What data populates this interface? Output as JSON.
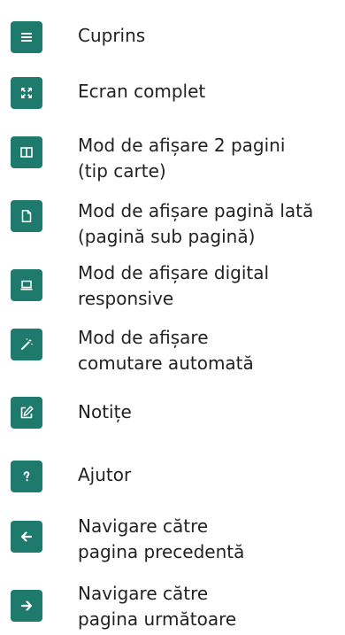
{
  "menu": {
    "accent_color": "#1f7a6e",
    "items": [
      {
        "label": "Cuprins",
        "icon": "list-icon"
      },
      {
        "label": "Ecran complet",
        "icon": "fullscreen-icon"
      },
      {
        "label": "Mod de afișare 2 pagini\n(tip carte)",
        "icon": "two-pages-icon"
      },
      {
        "label": "Mod de afișare pagină lată\n(pagină sub pagină)",
        "icon": "page-icon"
      },
      {
        "label": "Mod de afișare digital\nresponsive",
        "icon": "laptop-icon"
      },
      {
        "label": "Mod de afișare\ncomutare automată",
        "icon": "magic-wand-icon"
      },
      {
        "label": "Notițe",
        "icon": "edit-note-icon"
      },
      {
        "label": "Ajutor",
        "icon": "help-icon"
      },
      {
        "label": "Navigare către\npagina precedentă",
        "icon": "arrow-left-icon"
      },
      {
        "label": "Navigare către\npagina următoare",
        "icon": "arrow-right-icon"
      }
    ]
  }
}
